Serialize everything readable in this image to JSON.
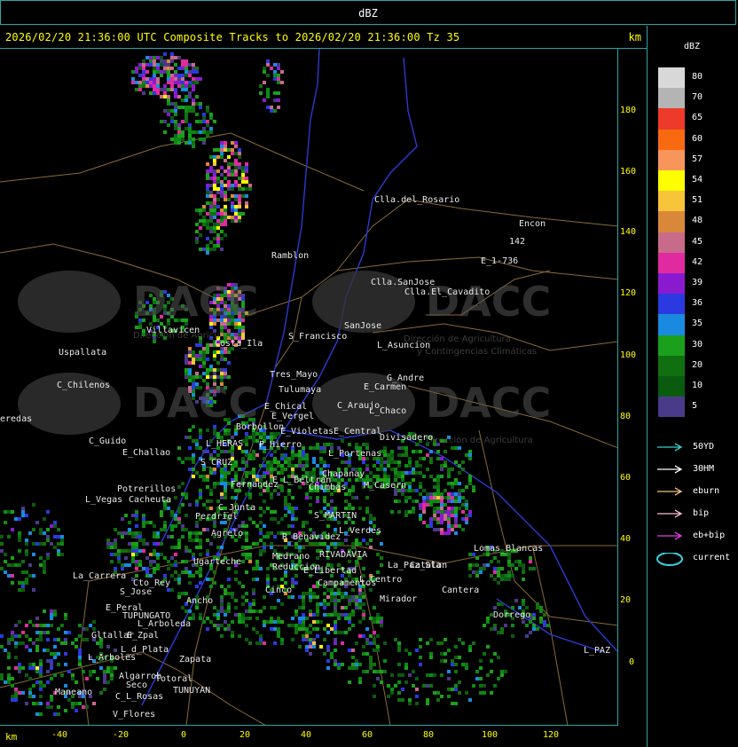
{
  "window": {
    "title": "dBZ"
  },
  "header": {
    "text": "2026/02/20 21:36:00 UTC Composite Tracks to 2026/02/20 21:36:00 Tz 35",
    "unit": "km"
  },
  "axes": {
    "x_unit": "km",
    "x_ticks": [
      "-40",
      "-20",
      "0",
      "20",
      "40",
      "60",
      "80",
      "100",
      "120"
    ],
    "y_ticks": [
      "180",
      "160",
      "140",
      "120",
      "100",
      "80",
      "60",
      "40",
      "20",
      "0"
    ]
  },
  "legend": {
    "title": "dBZ",
    "levels": [
      {
        "label": "80",
        "color": "#d8d8d8"
      },
      {
        "label": "70",
        "color": "#b4b4b4"
      },
      {
        "label": "65",
        "color": "#ee3a2a"
      },
      {
        "label": "60",
        "color": "#f76a10"
      },
      {
        "label": "57",
        "color": "#f7955a"
      },
      {
        "label": "54",
        "color": "#ffff00"
      },
      {
        "label": "51",
        "color": "#f7c43a"
      },
      {
        "label": "48",
        "color": "#d9883a"
      },
      {
        "label": "45",
        "color": "#c86a8a"
      },
      {
        "label": "42",
        "color": "#e02aa0"
      },
      {
        "label": "39",
        "color": "#8a1ad0"
      },
      {
        "label": "36",
        "color": "#2a3ae0"
      },
      {
        "label": "35",
        "color": "#1a8ae0"
      },
      {
        "label": "30",
        "color": "#1aa01a"
      },
      {
        "label": "20",
        "color": "#107010"
      },
      {
        "label": "10",
        "color": "#0a5a10"
      },
      {
        "label": "5",
        "color": "#4a3a8a"
      }
    ],
    "tracks": [
      {
        "label": "50YD",
        "color": "#3ad0d0",
        "kind": "arrow"
      },
      {
        "label": "30HM",
        "color": "#ffffff",
        "kind": "arrow"
      },
      {
        "label": "eburn",
        "color": "#f0c080",
        "kind": "arrow"
      },
      {
        "label": "bip",
        "color": "#f7c0d0",
        "kind": "arrow"
      },
      {
        "label": "eb+bip",
        "color": "#e040e0",
        "kind": "arrow"
      },
      {
        "label": "current",
        "color": "#3ad0e0",
        "kind": "ellipse"
      }
    ]
  },
  "map": {
    "watermark_text": "DACC",
    "watermark_sub_1": "Dirección de Agricultura",
    "watermark_sub_2": "y Contingencias Climáticas",
    "places": [
      "Clla.del_Rosario",
      "Encon",
      "142",
      "E_1-736",
      "Ramblon",
      "Clla.SanJose",
      "Clla.El_Cavadito",
      "Uspallata",
      "Villavicen",
      "Costa_Ila",
      "S_Francisco",
      "SanJose",
      "L_Asuncion",
      "C_Chilenos",
      "Tres_Mayo",
      "Tulumaya",
      "E_Carmen",
      "G_Andre",
      "eredas",
      "E_Chical",
      "E_Vergel",
      "C_Araujo",
      "L_Chaco",
      "Borbollon",
      "E_Violetas",
      "E_Central",
      "Divisadero",
      "C_Guido",
      "E_Challao",
      "L_HERAS",
      "P_Hierro",
      "S_CRUZ",
      "L_Portenas",
      "Chapanay",
      "E_L_Beltran",
      "M_Casern",
      "Chimbas",
      "Potrerillos",
      "L_Vegas",
      "Cacheuta",
      "Fernandez",
      "C_Junta",
      "Perdriel",
      "S_MARTIN",
      "L_Verdes",
      "Agrelo",
      "R_Benavidez",
      "Lomas_Blancas",
      "Ugarteche",
      "Medrano",
      "Reduccion",
      "RIVADAVIA",
      "La_Paz_Sta",
      "La_Carrera",
      "Cto_Rey",
      "S_Jose",
      "E_Libertad",
      "Campamentos",
      "L_Centro",
      "Catalan",
      "Cantera",
      "E_Peral",
      "TUPUNGATO",
      "Ancho",
      "Cinco",
      "Mirador",
      "Dorrego",
      "L_Arboleda",
      "Gltallar",
      "E_Zpal",
      "L_Arboles",
      "L_d_Plata",
      "Zapata",
      "L_PAZ",
      "Algarrob",
      "Seco",
      "Totoral",
      "Maneano",
      "C_L_Rosas",
      "TUNUYAN",
      "V_Flores"
    ]
  }
}
